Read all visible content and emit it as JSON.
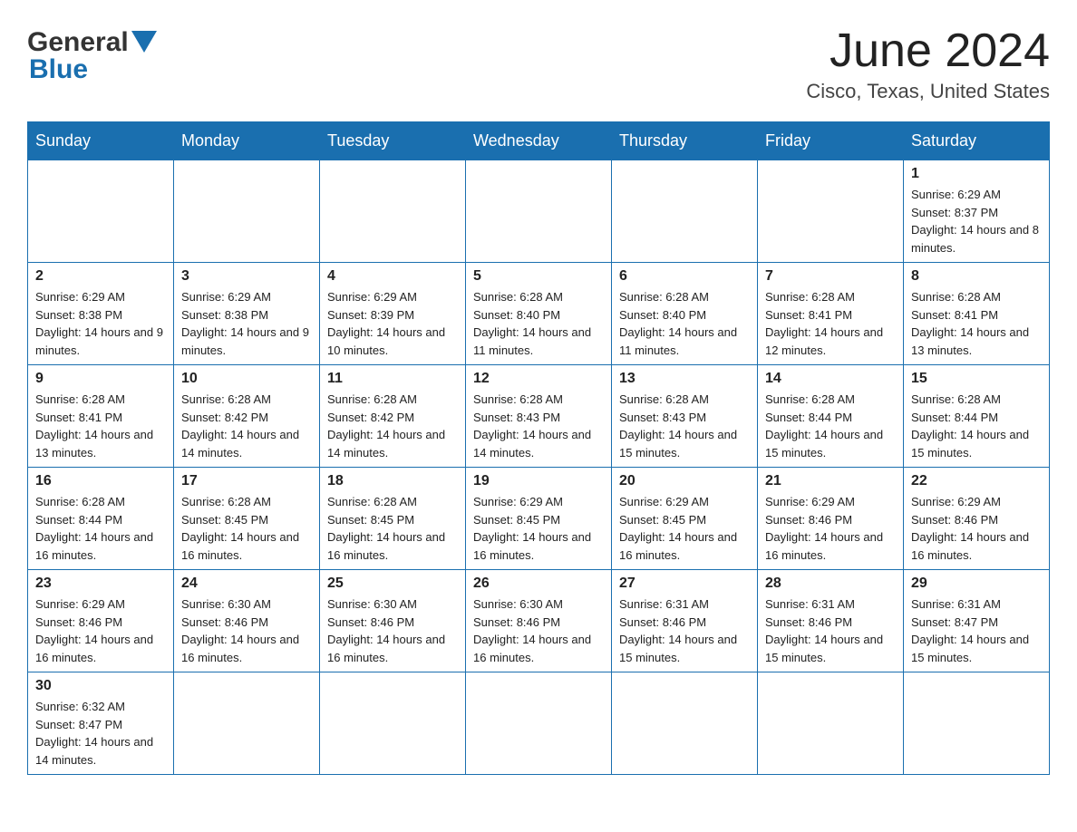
{
  "header": {
    "logo": {
      "general_text": "General",
      "blue_text": "Blue"
    },
    "title": "June 2024",
    "location": "Cisco, Texas, United States"
  },
  "weekdays": [
    "Sunday",
    "Monday",
    "Tuesday",
    "Wednesday",
    "Thursday",
    "Friday",
    "Saturday"
  ],
  "weeks": [
    [
      {
        "day": "",
        "sunrise": "",
        "sunset": "",
        "daylight": ""
      },
      {
        "day": "",
        "sunrise": "",
        "sunset": "",
        "daylight": ""
      },
      {
        "day": "",
        "sunrise": "",
        "sunset": "",
        "daylight": ""
      },
      {
        "day": "",
        "sunrise": "",
        "sunset": "",
        "daylight": ""
      },
      {
        "day": "",
        "sunrise": "",
        "sunset": "",
        "daylight": ""
      },
      {
        "day": "",
        "sunrise": "",
        "sunset": "",
        "daylight": ""
      },
      {
        "day": "1",
        "sunrise": "Sunrise: 6:29 AM",
        "sunset": "Sunset: 8:37 PM",
        "daylight": "Daylight: 14 hours and 8 minutes."
      }
    ],
    [
      {
        "day": "2",
        "sunrise": "Sunrise: 6:29 AM",
        "sunset": "Sunset: 8:38 PM",
        "daylight": "Daylight: 14 hours and 9 minutes."
      },
      {
        "day": "3",
        "sunrise": "Sunrise: 6:29 AM",
        "sunset": "Sunset: 8:38 PM",
        "daylight": "Daylight: 14 hours and 9 minutes."
      },
      {
        "day": "4",
        "sunrise": "Sunrise: 6:29 AM",
        "sunset": "Sunset: 8:39 PM",
        "daylight": "Daylight: 14 hours and 10 minutes."
      },
      {
        "day": "5",
        "sunrise": "Sunrise: 6:28 AM",
        "sunset": "Sunset: 8:40 PM",
        "daylight": "Daylight: 14 hours and 11 minutes."
      },
      {
        "day": "6",
        "sunrise": "Sunrise: 6:28 AM",
        "sunset": "Sunset: 8:40 PM",
        "daylight": "Daylight: 14 hours and 11 minutes."
      },
      {
        "day": "7",
        "sunrise": "Sunrise: 6:28 AM",
        "sunset": "Sunset: 8:41 PM",
        "daylight": "Daylight: 14 hours and 12 minutes."
      },
      {
        "day": "8",
        "sunrise": "Sunrise: 6:28 AM",
        "sunset": "Sunset: 8:41 PM",
        "daylight": "Daylight: 14 hours and 13 minutes."
      }
    ],
    [
      {
        "day": "9",
        "sunrise": "Sunrise: 6:28 AM",
        "sunset": "Sunset: 8:41 PM",
        "daylight": "Daylight: 14 hours and 13 minutes."
      },
      {
        "day": "10",
        "sunrise": "Sunrise: 6:28 AM",
        "sunset": "Sunset: 8:42 PM",
        "daylight": "Daylight: 14 hours and 14 minutes."
      },
      {
        "day": "11",
        "sunrise": "Sunrise: 6:28 AM",
        "sunset": "Sunset: 8:42 PM",
        "daylight": "Daylight: 14 hours and 14 minutes."
      },
      {
        "day": "12",
        "sunrise": "Sunrise: 6:28 AM",
        "sunset": "Sunset: 8:43 PM",
        "daylight": "Daylight: 14 hours and 14 minutes."
      },
      {
        "day": "13",
        "sunrise": "Sunrise: 6:28 AM",
        "sunset": "Sunset: 8:43 PM",
        "daylight": "Daylight: 14 hours and 15 minutes."
      },
      {
        "day": "14",
        "sunrise": "Sunrise: 6:28 AM",
        "sunset": "Sunset: 8:44 PM",
        "daylight": "Daylight: 14 hours and 15 minutes."
      },
      {
        "day": "15",
        "sunrise": "Sunrise: 6:28 AM",
        "sunset": "Sunset: 8:44 PM",
        "daylight": "Daylight: 14 hours and 15 minutes."
      }
    ],
    [
      {
        "day": "16",
        "sunrise": "Sunrise: 6:28 AM",
        "sunset": "Sunset: 8:44 PM",
        "daylight": "Daylight: 14 hours and 16 minutes."
      },
      {
        "day": "17",
        "sunrise": "Sunrise: 6:28 AM",
        "sunset": "Sunset: 8:45 PM",
        "daylight": "Daylight: 14 hours and 16 minutes."
      },
      {
        "day": "18",
        "sunrise": "Sunrise: 6:28 AM",
        "sunset": "Sunset: 8:45 PM",
        "daylight": "Daylight: 14 hours and 16 minutes."
      },
      {
        "day": "19",
        "sunrise": "Sunrise: 6:29 AM",
        "sunset": "Sunset: 8:45 PM",
        "daylight": "Daylight: 14 hours and 16 minutes."
      },
      {
        "day": "20",
        "sunrise": "Sunrise: 6:29 AM",
        "sunset": "Sunset: 8:45 PM",
        "daylight": "Daylight: 14 hours and 16 minutes."
      },
      {
        "day": "21",
        "sunrise": "Sunrise: 6:29 AM",
        "sunset": "Sunset: 8:46 PM",
        "daylight": "Daylight: 14 hours and 16 minutes."
      },
      {
        "day": "22",
        "sunrise": "Sunrise: 6:29 AM",
        "sunset": "Sunset: 8:46 PM",
        "daylight": "Daylight: 14 hours and 16 minutes."
      }
    ],
    [
      {
        "day": "23",
        "sunrise": "Sunrise: 6:29 AM",
        "sunset": "Sunset: 8:46 PM",
        "daylight": "Daylight: 14 hours and 16 minutes."
      },
      {
        "day": "24",
        "sunrise": "Sunrise: 6:30 AM",
        "sunset": "Sunset: 8:46 PM",
        "daylight": "Daylight: 14 hours and 16 minutes."
      },
      {
        "day": "25",
        "sunrise": "Sunrise: 6:30 AM",
        "sunset": "Sunset: 8:46 PM",
        "daylight": "Daylight: 14 hours and 16 minutes."
      },
      {
        "day": "26",
        "sunrise": "Sunrise: 6:30 AM",
        "sunset": "Sunset: 8:46 PM",
        "daylight": "Daylight: 14 hours and 16 minutes."
      },
      {
        "day": "27",
        "sunrise": "Sunrise: 6:31 AM",
        "sunset": "Sunset: 8:46 PM",
        "daylight": "Daylight: 14 hours and 15 minutes."
      },
      {
        "day": "28",
        "sunrise": "Sunrise: 6:31 AM",
        "sunset": "Sunset: 8:46 PM",
        "daylight": "Daylight: 14 hours and 15 minutes."
      },
      {
        "day": "29",
        "sunrise": "Sunrise: 6:31 AM",
        "sunset": "Sunset: 8:47 PM",
        "daylight": "Daylight: 14 hours and 15 minutes."
      }
    ],
    [
      {
        "day": "30",
        "sunrise": "Sunrise: 6:32 AM",
        "sunset": "Sunset: 8:47 PM",
        "daylight": "Daylight: 14 hours and 14 minutes."
      },
      {
        "day": "",
        "sunrise": "",
        "sunset": "",
        "daylight": ""
      },
      {
        "day": "",
        "sunrise": "",
        "sunset": "",
        "daylight": ""
      },
      {
        "day": "",
        "sunrise": "",
        "sunset": "",
        "daylight": ""
      },
      {
        "day": "",
        "sunrise": "",
        "sunset": "",
        "daylight": ""
      },
      {
        "day": "",
        "sunrise": "",
        "sunset": "",
        "daylight": ""
      },
      {
        "day": "",
        "sunrise": "",
        "sunset": "",
        "daylight": ""
      }
    ]
  ]
}
